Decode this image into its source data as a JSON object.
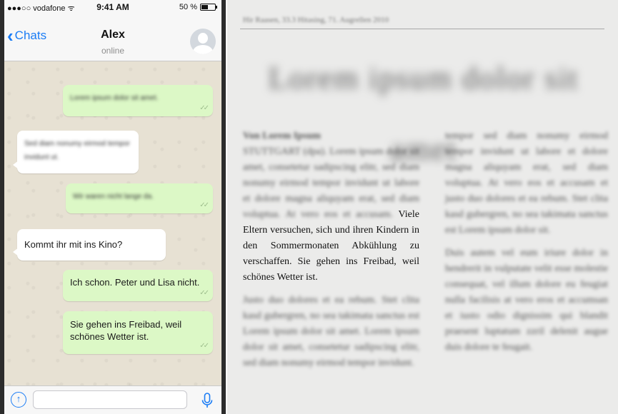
{
  "phone": {
    "status_bar": {
      "carrier": "●●●○○ vodafone ᯤ",
      "time": "9:41 AM",
      "battery_text": "50 %",
      "battery_level": 0.5
    },
    "nav": {
      "back_label": "Chats",
      "contact_name": "Alex",
      "contact_status": "online"
    },
    "messages": [
      {
        "direction": "out",
        "text": "Lorem ipsum dolor sit amet.",
        "blurred": true
      },
      {
        "direction": "in",
        "text": "Sed diam nonumy eirmod tempor invidunt ut.",
        "blurred": true
      },
      {
        "direction": "out",
        "text": "Wir waren nicht lange da.",
        "blurred": true
      },
      {
        "direction": "in",
        "text": "Kommt ihr mit ins Kino?",
        "blurred": false
      },
      {
        "direction": "out",
        "text": "Ich schon. Peter und Lisa nicht.",
        "blurred": false
      },
      {
        "direction": "out",
        "text": "Sie gehen ins Freibad, weil schönes Wetter ist.",
        "blurred": false
      }
    ],
    "ticks": "✓✓",
    "input_placeholder": "",
    "colors": {
      "accent": "#1a7cf5",
      "outgoing": "#dcf8c6",
      "incoming": "#ffffff"
    }
  },
  "newspaper": {
    "dateline": "Hir Raasen, 33.3 Hitasing, 71. Augrellen 2010",
    "headline": "Lorem ipsum dolor sit amet",
    "col1_byline": "Von Lorem Ipsum",
    "col1_blurred_intro": "STUTTGART (dpa). Lorem ipsum dolor sit amet, consetetur sadipscing elitr, sed diam nonumy eirmod tempor invidunt ut labore et dolore magna aliquyam erat, sed diam voluptua. At vero eos et accusam.",
    "col1_sharp": "Viele Eltern versuchen, sich und ihren Kindern in den Sommermonaten Abkühlung zu verschaffen. Sie gehen ins Freibad, weil schönes Wetter ist.",
    "col1_blurred_after": "Justo duo dolores et ea rebum. Stet clita kasd gubergren, no sea takimata sanctus est Lorem ipsum dolor sit amet. Lorem ipsum dolor sit amet, consetetur sadipscing elitr, sed diam nonumy eirmod tempor invidunt.",
    "col2_blurred_a": "tempor sed diam nonumy eirmod tempor invidunt ut labore et dolore magna aliquyam erat, sed diam voluptua. At vero eos et accusam et justo duo dolores et ea rebum. Stet clita kasd gubergren, no sea takimata sanctus est Lorem ipsum dolor sit.",
    "col2_blurred_b": "Duis autem vel eum iriure dolor in hendrerit in vulputate velit esse molestie consequat, vel illum dolore eu feugiat nulla facilisis at vero eros et accumsan et iusto odio dignissim qui blandit praesent luptatum zzril delenit augue duis dolore te feugait."
  }
}
